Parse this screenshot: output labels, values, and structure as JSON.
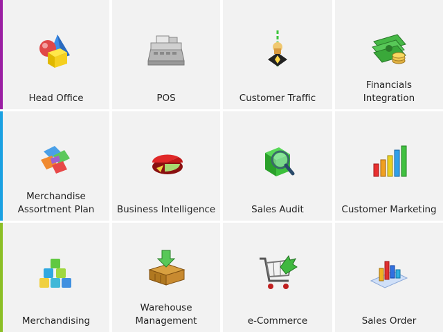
{
  "colors": {
    "row1_accent": "#9b1fa3",
    "row2_accent": "#1ba1e2",
    "row3_accent": "#8cbf26",
    "tile_bg": "#f2f2f2"
  },
  "tiles": [
    {
      "label": "Head Office",
      "icon": "shapes-icon"
    },
    {
      "label": "POS",
      "icon": "cash-register-icon"
    },
    {
      "label": "Customer Traffic",
      "icon": "traffic-marker-icon"
    },
    {
      "label": "Financials\nIntegration",
      "icon": "money-stack-icon"
    },
    {
      "label": "Merchandise\nAssortment Plan",
      "icon": "puzzle-blocks-icon"
    },
    {
      "label": "Business Intelligence",
      "icon": "pie-chart-icon"
    },
    {
      "label": "Sales Audit",
      "icon": "magnifier-cube-icon"
    },
    {
      "label": "Customer Marketing",
      "icon": "bar-chart-icon"
    },
    {
      "label": "Merchandising",
      "icon": "cubes-icon"
    },
    {
      "label": "Warehouse\nManagement",
      "icon": "warehouse-box-icon"
    },
    {
      "label": "e-Commerce",
      "icon": "shopping-cart-icon"
    },
    {
      "label": "Sales Order",
      "icon": "3d-bar-chart-icon"
    }
  ]
}
